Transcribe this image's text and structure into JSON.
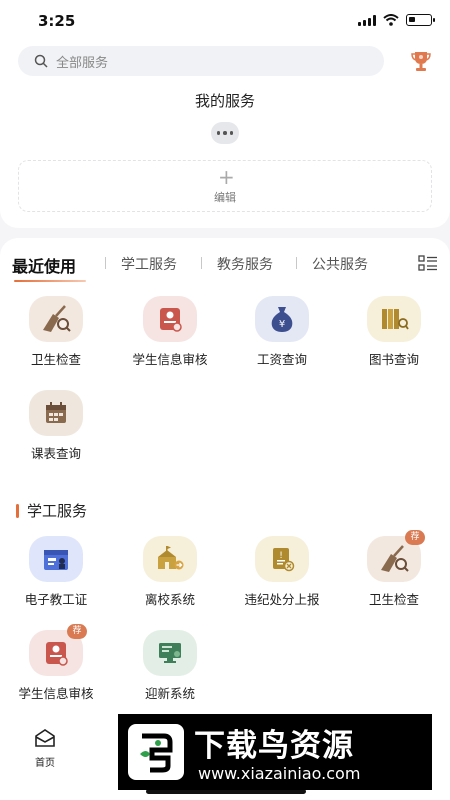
{
  "status_bar": {
    "time": "3:25"
  },
  "search": {
    "placeholder": "全部服务"
  },
  "my_services": {
    "title": "我的服务",
    "edit_label": "编辑"
  },
  "tabs": [
    {
      "label": "最近使用",
      "active": true
    },
    {
      "label": "学工服务",
      "active": false
    },
    {
      "label": "教务服务",
      "active": false
    },
    {
      "label": "公共服务",
      "active": false
    }
  ],
  "recent_apps": [
    {
      "label": "卫生检查",
      "icon": "broom-magnifier-icon"
    },
    {
      "label": "学生信息审核",
      "icon": "student-id-card-icon"
    },
    {
      "label": "工资查询",
      "icon": "money-bag-icon"
    },
    {
      "label": "图书查询",
      "icon": "books-icon"
    },
    {
      "label": "课表查询",
      "icon": "calendar-icon"
    }
  ],
  "section": {
    "title": "学工服务"
  },
  "student_affairs_apps": [
    {
      "label": "电子教工证",
      "icon": "staff-id-icon"
    },
    {
      "label": "离校系统",
      "icon": "school-leave-icon"
    },
    {
      "label": "违纪处分上报",
      "icon": "discipline-report-icon"
    },
    {
      "label": "卫生检查",
      "icon": "broom-magnifier-icon",
      "badge": "荐"
    },
    {
      "label": "学生信息审核",
      "icon": "student-id-card-icon",
      "badge": "荐"
    },
    {
      "label": "迎新系统",
      "icon": "welcome-monitor-icon"
    }
  ],
  "bottom_nav": {
    "home_label": "首页"
  },
  "watermark": {
    "title": "下载鸟资源",
    "url": "www.xiazainiao.com"
  },
  "colors": {
    "accent": "#e46f3a",
    "badge": "#d97a52",
    "background": "#f5f5f7"
  }
}
